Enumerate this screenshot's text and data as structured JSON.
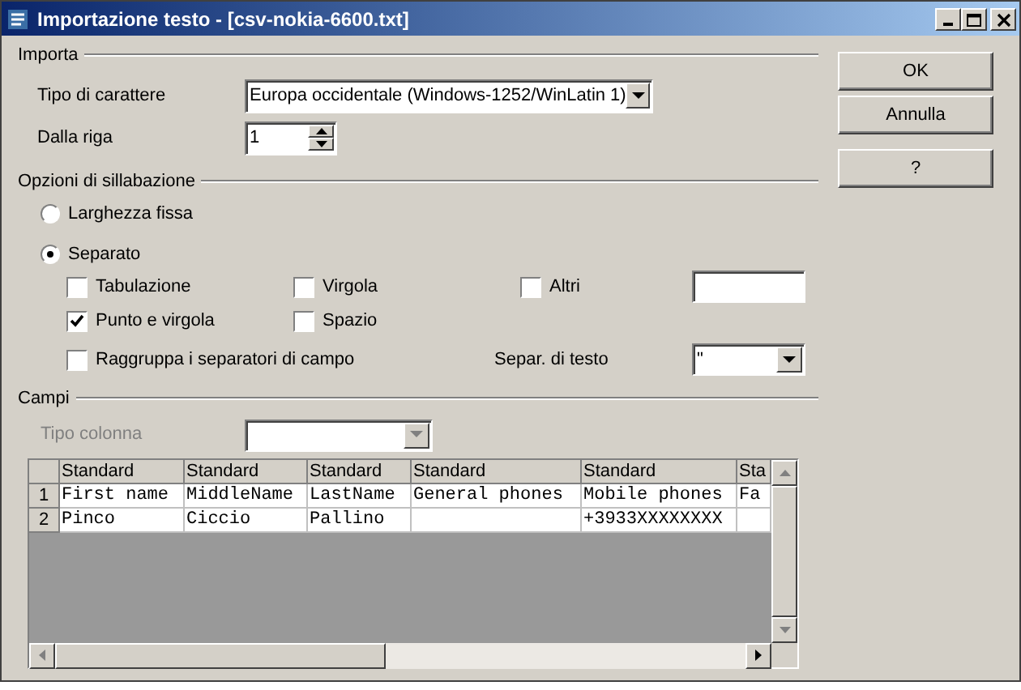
{
  "window": {
    "title": "Importazione testo - [csv-nokia-6600.txt]"
  },
  "import": {
    "heading": "Importa",
    "charset": {
      "label": "Tipo di carattere",
      "value": "Europa occidentale (Windows-1252/WinLatin 1)"
    },
    "from_row": {
      "label": "Dalla riga",
      "value": "1"
    }
  },
  "separator_options": {
    "heading": "Opzioni di sillabazione",
    "modes": [
      {
        "label": "Larghezza fissa",
        "selected": false
      },
      {
        "label": "Separato",
        "selected": true
      }
    ],
    "separators": [
      {
        "label": "Tabulazione",
        "checked": false
      },
      {
        "label": "Virgola",
        "checked": false
      },
      {
        "label": "Altri",
        "checked": false
      },
      {
        "label": "Punto e virgola",
        "checked": true
      },
      {
        "label": "Spazio",
        "checked": false
      }
    ],
    "merge": {
      "label": "Raggruppa i separatori di campo",
      "checked": false
    },
    "text_delimiter": {
      "label": "Separ. di testo",
      "value": "\""
    }
  },
  "fields": {
    "heading": "Campi",
    "column_type": {
      "label": "Tipo colonna",
      "disabled": true
    },
    "table": {
      "column_types": [
        "Standard",
        "Standard",
        "Standard",
        "Standard",
        "Standard",
        "Sta"
      ],
      "rows": [
        {
          "number": "1",
          "cells": [
            "First name",
            "MiddleName",
            "LastName",
            "General phones",
            "Mobile phones",
            "Fa"
          ]
        },
        {
          "number": "2",
          "cells": [
            "Pinco",
            "Ciccio",
            "Pallino",
            "",
            "+3933XXXXXXXX",
            ""
          ]
        }
      ]
    }
  },
  "buttons": [
    {
      "label": "OK"
    },
    {
      "label": "Annulla"
    },
    {
      "label": "?"
    }
  ]
}
